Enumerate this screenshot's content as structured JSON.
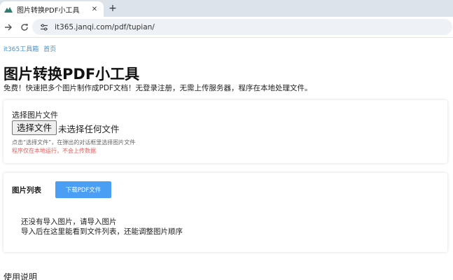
{
  "browser": {
    "tab_title": "图片转换PDF小工具",
    "url": "it365.janqi.com/pdf/tupian/"
  },
  "breadcrumb": [
    "it365工具箱",
    "首页"
  ],
  "page": {
    "title": "图片转换PDF小工具",
    "description": "免费！快速把多个图片制作成PDF文档！无登录注册，无需上传服务器，程序在本地处理文件。"
  },
  "upload": {
    "label": "选择图片文件",
    "button_label": "选择文件",
    "file_status": "未选择任何文件",
    "hint": "点击“选择文件”，在弹出的对话框里选择图片文件",
    "warning": "程序仅在本地运行，不会上传数据"
  },
  "image_list": {
    "title": "图片列表",
    "download_label": "下载PDF文件",
    "empty_line1": "还没有导入图片，请导入图片",
    "empty_line2": "导入后在这里能看到文件列表，还能调整图片顺序"
  },
  "usage": {
    "title": "使用说明"
  },
  "colors": {
    "accent": "#4a9ff5",
    "link": "#4a90c8",
    "warning": "#e06060",
    "tabstrip": "#dde3ea"
  },
  "icons": {
    "tab_favicon": "mountain-icon",
    "tab_close": "close-icon",
    "new_tab": "plus-icon",
    "back": "arrow-right-icon",
    "reload": "reload-icon",
    "site_info": "tune-icon"
  }
}
